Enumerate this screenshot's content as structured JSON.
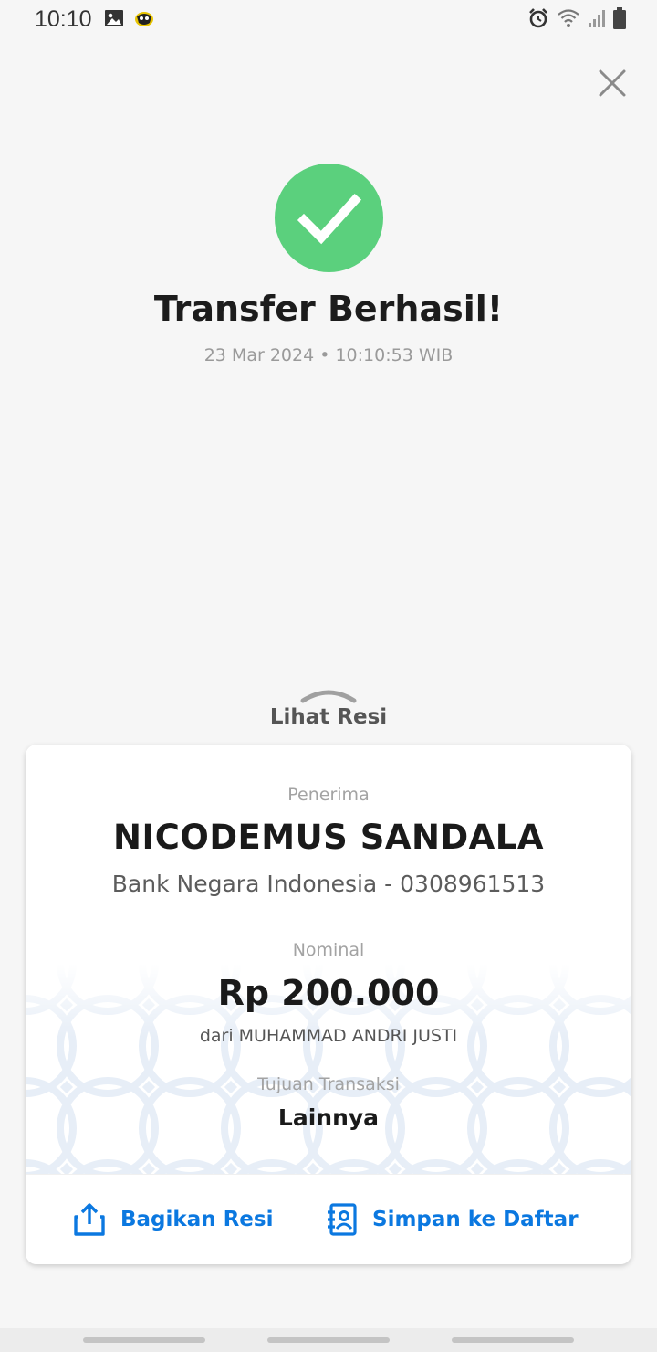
{
  "status_bar": {
    "time": "10:10",
    "left_icons": [
      "gallery-icon",
      "app-notification-icon"
    ],
    "right_icons": [
      "alarm-icon",
      "wifi-icon",
      "signal-icon",
      "battery-icon"
    ]
  },
  "header": {
    "close_icon": "close-icon"
  },
  "success": {
    "icon": "check-icon",
    "icon_color": "#5bd07d",
    "title": "Transfer Berhasil!",
    "datetime": "23 Mar 2024 • 10:10:53 WIB"
  },
  "receipt_toggle": {
    "label": "Lihat Resi",
    "icon": "chevron-up-icon"
  },
  "receipt": {
    "recipient_label": "Penerima",
    "recipient_name": "NICODEMUS SANDALA",
    "recipient_bank": "Bank Negara Indonesia - 0308961513",
    "amount_label": "Nominal",
    "amount": "Rp 200.000",
    "sender": "dari MUHAMMAD ANDRI JUSTI",
    "purpose_label": "Tujuan Transaksi",
    "purpose": "Lainnya"
  },
  "actions": {
    "share_label": "Bagikan Resi",
    "share_icon": "share-icon",
    "save_label": "Simpan ke Daftar",
    "save_icon": "contact-book-icon",
    "accent_color": "#0b78e0"
  }
}
